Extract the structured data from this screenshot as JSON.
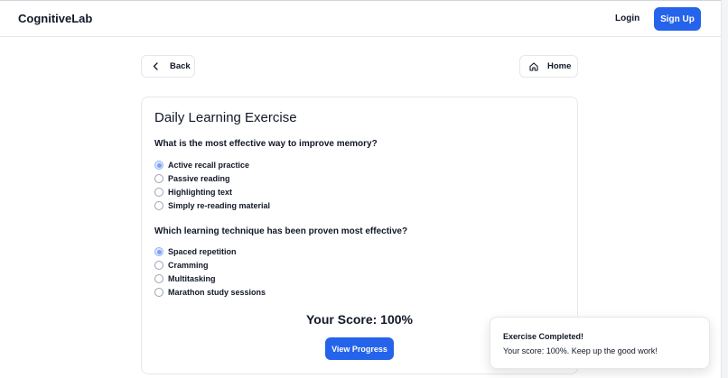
{
  "navbar": {
    "brand": "CognitiveLab",
    "login_label": "Login",
    "signup_label": "Sign Up"
  },
  "nav_buttons": {
    "back_label": "Back",
    "home_label": "Home",
    "back_icon": "chevron-left-icon",
    "home_icon": "home-icon"
  },
  "exercise": {
    "title": "Daily Learning Exercise",
    "questions": [
      {
        "text": "What is the most effective way to improve memory?",
        "options": [
          {
            "label": "Active recall practice",
            "selected": true
          },
          {
            "label": "Passive reading",
            "selected": false
          },
          {
            "label": "Highlighting text",
            "selected": false
          },
          {
            "label": "Simply re-reading material",
            "selected": false
          }
        ]
      },
      {
        "text": "Which learning technique has been proven most effective?",
        "options": [
          {
            "label": "Spaced repetition",
            "selected": true
          },
          {
            "label": "Cramming",
            "selected": false
          },
          {
            "label": "Multitasking",
            "selected": false
          },
          {
            "label": "Marathon study sessions",
            "selected": false
          }
        ]
      }
    ],
    "score_text": "Your Score: 100%",
    "view_progress_label": "View Progress"
  },
  "toast": {
    "title": "Exercise Completed!",
    "body": "Your score: 100%. Keep up the good work!"
  },
  "colors": {
    "primary": "#2563eb",
    "border": "#e5e7eb",
    "text": "#111827"
  }
}
